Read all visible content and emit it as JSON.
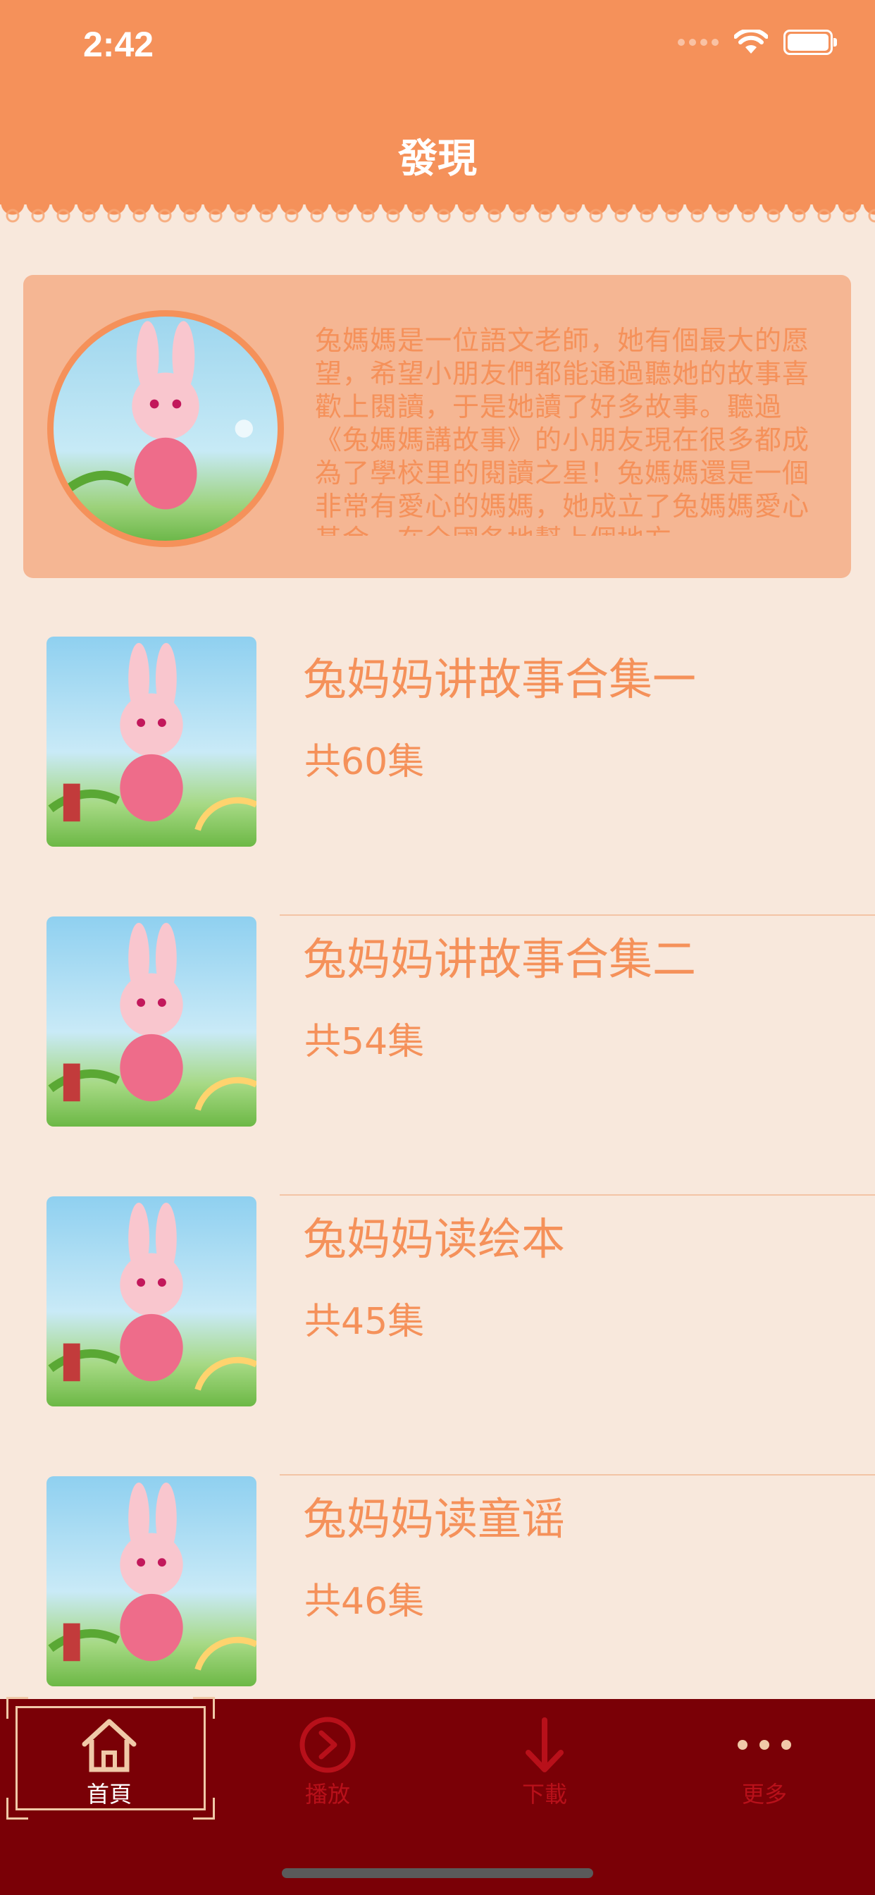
{
  "status_bar": {
    "time": "2:42"
  },
  "nav": {
    "title": "發現"
  },
  "intro": {
    "text": "兔媽媽是一位語文老師，她有個最大的愿望，希望小朋友們都能通過聽她的故事喜歡上閱讀，于是她讀了好多故事。聽過《兔媽媽講故事》的小朋友現在很多都成為了學校里的閱讀之星！兔媽媽還是一個非常有愛心的媽媽，她成立了兔媽媽愛心基金，在全國各地幫上個地方"
  },
  "albums": [
    {
      "title": "兔妈妈讲故事合集一",
      "count": "共60集"
    },
    {
      "title": "兔妈妈讲故事合集二",
      "count": "共54集"
    },
    {
      "title": "兔妈妈读绘本",
      "count": "共45集"
    },
    {
      "title": "兔妈妈读童谣",
      "count": "共46集"
    }
  ],
  "tabs": [
    {
      "label": "首頁",
      "icon": "home-icon",
      "active": true
    },
    {
      "label": "播放",
      "icon": "play-circle-icon",
      "active": false
    },
    {
      "label": "下載",
      "icon": "download-arrow-icon",
      "active": false
    },
    {
      "label": "更多",
      "icon": "more-dots-icon",
      "active": false
    }
  ],
  "colors": {
    "header": "#F5915A",
    "background": "#F8E8DC",
    "card": "#F5B693",
    "accent_text": "#F5915A",
    "tab_bar": "#7A0006",
    "tab_active": "#FFFFFF",
    "tab_inactive": "#B8101A"
  }
}
